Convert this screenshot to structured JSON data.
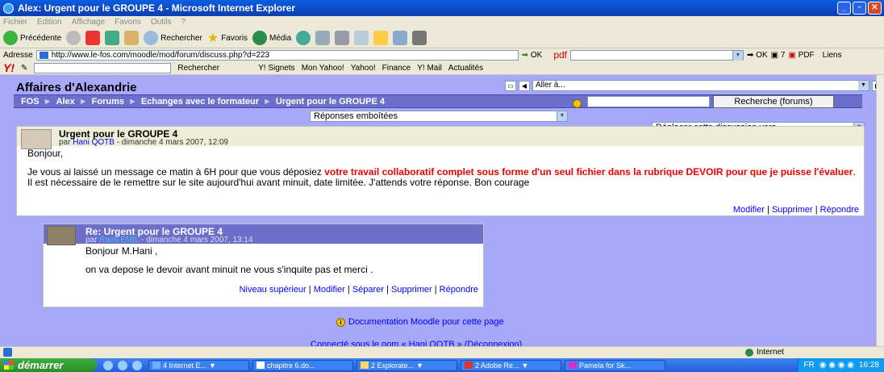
{
  "window": {
    "title": "Alex: Urgent pour le GROUPE 4 - Microsoft Internet Explorer"
  },
  "menu": [
    "Fichier",
    "Edition",
    "Affichage",
    "Favoris",
    "Outils",
    "?"
  ],
  "toolbar": {
    "back": "Précédente",
    "search": "Rechercher",
    "favorites": "Favoris",
    "media": "Média"
  },
  "address": {
    "label": "Adresse",
    "url": "http://www.le-fos.com/moodle/mod/forum/discuss.php?d=223",
    "go": "OK",
    "pdf": "pdf",
    "ok2": "OK",
    "count": "7",
    "pdf_label": "PDF",
    "links": "Liens"
  },
  "yahoo": {
    "search": "Rechercher",
    "items": [
      "Y! Signets",
      "Mon Yahoo!",
      "Yahoo!",
      "Finance",
      "Y! Mail",
      "Actualités"
    ]
  },
  "page": {
    "site_title": "Affaires d'Alexandrie",
    "jump_placeholder": "Aller à...",
    "breadcrumb": [
      "FOS",
      "Alex",
      "Forums",
      "Echanges avec le formateur",
      "Urgent pour le GROUPE 4"
    ],
    "search_button": "Recherche (forums)",
    "display_mode": "Réponses emboîtées",
    "move_discussion": "Déplacer cette discussion vers...",
    "post1": {
      "title": "Urgent pour le GROUPE 4",
      "by_prefix": "par",
      "author": "Hani QOTB",
      "date": " - dimanche 4 mars 2007, 12:09",
      "greeting": "Bonjour,",
      "body_start": "Je vous ai laissé un message ce matin à 6H pour que vous déposiez ",
      "body_red": "votre travail collaboratif complet sous forme d'un seul fichier dans la rubrique DEVOIR pour que je puisse l'évaluer",
      "body_end": ". Il est nécessaire de le remettre sur le site aujourd'hui avant minuit, date limitée.  J'attends votre réponse. Bon courage",
      "commands": [
        "Modifier",
        "Supprimer",
        "Répondre"
      ]
    },
    "post2": {
      "title": "Re: Urgent pour le GROUPE 4",
      "by_prefix": "par",
      "author": "Rami EMIL",
      "date": " - dimanche 4 mars 2007, 13:14",
      "greeting": "Bonjour M.Hani ,",
      "body": "on va depose le devoir avant minuit ne vous s'inquite pas et merci .",
      "commands": [
        "Niveau supérieur",
        "Modifier",
        "Séparer",
        "Supprimer",
        "Répondre"
      ]
    },
    "docs": "Documentation Moodle pour cette page",
    "login_info": "Connecté sous le nom « Hani QOTB » (Déconnexion)"
  },
  "status": {
    "zone": "Internet"
  },
  "taskbar": {
    "start": "démarrer",
    "tasks": [
      "4 Internet E...",
      "chapitre 6.do...",
      "2 Explorate...",
      "2 Adobe Re...",
      "Pamela for Sk..."
    ],
    "lang": "FR",
    "clock": "16:28"
  }
}
